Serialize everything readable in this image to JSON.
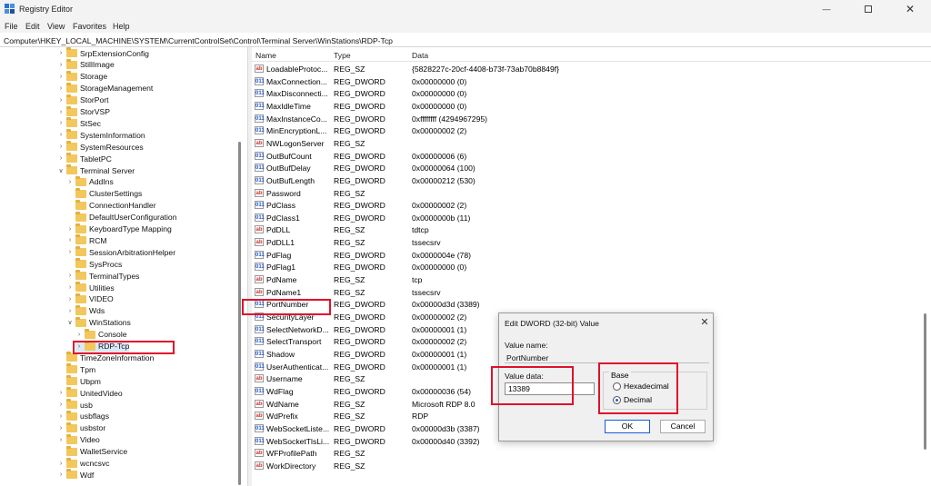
{
  "window": {
    "title": "Registry Editor"
  },
  "menu": [
    "File",
    "Edit",
    "View",
    "Favorites",
    "Help"
  ],
  "address": "Computer\\HKEY_LOCAL_MACHINE\\SYSTEM\\CurrentControlSet\\Control\\Terminal Server\\WinStations\\RDP-Tcp",
  "tree": [
    {
      "label": "SrpExtensionConfig",
      "level": 0,
      "expanded": false
    },
    {
      "label": "StillImage",
      "level": 0,
      "expanded": false
    },
    {
      "label": "Storage",
      "level": 0,
      "expanded": false
    },
    {
      "label": "StorageManagement",
      "level": 0,
      "expanded": false
    },
    {
      "label": "StorPort",
      "level": 0,
      "expanded": false
    },
    {
      "label": "StorVSP",
      "level": 0,
      "expanded": false
    },
    {
      "label": "StSec",
      "level": 0,
      "expanded": false
    },
    {
      "label": "SystemInformation",
      "level": 0,
      "expanded": false
    },
    {
      "label": "SystemResources",
      "level": 0,
      "expanded": false
    },
    {
      "label": "TabletPC",
      "level": 0,
      "expanded": false
    },
    {
      "label": "Terminal Server",
      "level": 0,
      "expanded": true
    },
    {
      "label": "AddIns",
      "level": 1,
      "expanded": false
    },
    {
      "label": "ClusterSettings",
      "level": 1,
      "expanded": false,
      "leaf": true
    },
    {
      "label": "ConnectionHandler",
      "level": 1,
      "expanded": false,
      "leaf": true
    },
    {
      "label": "DefaultUserConfiguration",
      "level": 1,
      "expanded": false,
      "leaf": true
    },
    {
      "label": "KeyboardType Mapping",
      "level": 1,
      "expanded": false
    },
    {
      "label": "RCM",
      "level": 1,
      "expanded": false
    },
    {
      "label": "SessionArbitrationHelper",
      "level": 1,
      "expanded": false
    },
    {
      "label": "SysProcs",
      "level": 1,
      "expanded": false,
      "leaf": true
    },
    {
      "label": "TerminalTypes",
      "level": 1,
      "expanded": false
    },
    {
      "label": "Utilities",
      "level": 1,
      "expanded": false
    },
    {
      "label": "VIDEO",
      "level": 1,
      "expanded": false
    },
    {
      "label": "Wds",
      "level": 1,
      "expanded": false
    },
    {
      "label": "WinStations",
      "level": 1,
      "expanded": true
    },
    {
      "label": "Console",
      "level": 2,
      "expanded": false
    },
    {
      "label": "RDP-Tcp",
      "level": 2,
      "expanded": false,
      "selected": true
    },
    {
      "label": "TimeZoneInformation",
      "level": 0,
      "expanded": false,
      "leaf": true
    },
    {
      "label": "Tpm",
      "level": 0,
      "expanded": false,
      "leaf": true
    },
    {
      "label": "Ubpm",
      "level": 0,
      "expanded": false,
      "leaf": true
    },
    {
      "label": "UnitedVideo",
      "level": 0,
      "expanded": false
    },
    {
      "label": "usb",
      "level": 0,
      "expanded": false
    },
    {
      "label": "usbflags",
      "level": 0,
      "expanded": false
    },
    {
      "label": "usbstor",
      "level": 0,
      "expanded": false
    },
    {
      "label": "Video",
      "level": 0,
      "expanded": false
    },
    {
      "label": "WalletService",
      "level": 0,
      "expanded": false,
      "leaf": true
    },
    {
      "label": "wcncsvc",
      "level": 0,
      "expanded": false
    },
    {
      "label": "Wdf",
      "level": 0,
      "expanded": false
    }
  ],
  "columns": {
    "name": "Name",
    "type": "Type",
    "data": "Data"
  },
  "values": [
    {
      "name": "LoadableProtoc...",
      "type": "REG_SZ",
      "data": "{5828227c-20cf-4408-b73f-73ab70b8849f}"
    },
    {
      "name": "MaxConnection...",
      "type": "REG_DWORD",
      "data": "0x00000000 (0)"
    },
    {
      "name": "MaxDisconnecti...",
      "type": "REG_DWORD",
      "data": "0x00000000 (0)"
    },
    {
      "name": "MaxIdleTime",
      "type": "REG_DWORD",
      "data": "0x00000000 (0)"
    },
    {
      "name": "MaxInstanceCo...",
      "type": "REG_DWORD",
      "data": "0xffffffff (4294967295)"
    },
    {
      "name": "MinEncryptionL...",
      "type": "REG_DWORD",
      "data": "0x00000002 (2)"
    },
    {
      "name": "NWLogonServer",
      "type": "REG_SZ",
      "data": ""
    },
    {
      "name": "OutBufCount",
      "type": "REG_DWORD",
      "data": "0x00000006 (6)"
    },
    {
      "name": "OutBufDelay",
      "type": "REG_DWORD",
      "data": "0x00000064 (100)"
    },
    {
      "name": "OutBufLength",
      "type": "REG_DWORD",
      "data": "0x00000212 (530)"
    },
    {
      "name": "Password",
      "type": "REG_SZ",
      "data": ""
    },
    {
      "name": "PdClass",
      "type": "REG_DWORD",
      "data": "0x00000002 (2)"
    },
    {
      "name": "PdClass1",
      "type": "REG_DWORD",
      "data": "0x0000000b (11)"
    },
    {
      "name": "PdDLL",
      "type": "REG_SZ",
      "data": "tdtcp"
    },
    {
      "name": "PdDLL1",
      "type": "REG_SZ",
      "data": "tssecsrv"
    },
    {
      "name": "PdFlag",
      "type": "REG_DWORD",
      "data": "0x0000004e (78)"
    },
    {
      "name": "PdFlag1",
      "type": "REG_DWORD",
      "data": "0x00000000 (0)"
    },
    {
      "name": "PdName",
      "type": "REG_SZ",
      "data": "tcp"
    },
    {
      "name": "PdName1",
      "type": "REG_SZ",
      "data": "tssecsrv"
    },
    {
      "name": "PortNumber",
      "type": "REG_DWORD",
      "data": "0x00000d3d (3389)"
    },
    {
      "name": "SecurityLayer",
      "type": "REG_DWORD",
      "data": "0x00000002 (2)"
    },
    {
      "name": "SelectNetworkD...",
      "type": "REG_DWORD",
      "data": "0x00000001 (1)"
    },
    {
      "name": "SelectTransport",
      "type": "REG_DWORD",
      "data": "0x00000002 (2)"
    },
    {
      "name": "Shadow",
      "type": "REG_DWORD",
      "data": "0x00000001 (1)"
    },
    {
      "name": "UserAuthenticat...",
      "type": "REG_DWORD",
      "data": "0x00000001 (1)"
    },
    {
      "name": "Username",
      "type": "REG_SZ",
      "data": ""
    },
    {
      "name": "WdFlag",
      "type": "REG_DWORD",
      "data": "0x00000036 (54)"
    },
    {
      "name": "WdName",
      "type": "REG_SZ",
      "data": "Microsoft RDP 8.0"
    },
    {
      "name": "WdPrefix",
      "type": "REG_SZ",
      "data": "RDP"
    },
    {
      "name": "WebSocketListe...",
      "type": "REG_DWORD",
      "data": "0x00000d3b (3387)"
    },
    {
      "name": "WebSocketTlsLi...",
      "type": "REG_DWORD",
      "data": "0x00000d40 (3392)"
    },
    {
      "name": "WFProfilePath",
      "type": "REG_SZ",
      "data": ""
    },
    {
      "name": "WorkDirectory",
      "type": "REG_SZ",
      "data": ""
    }
  ],
  "icons": {
    "sz": "ab",
    "dword": "011"
  },
  "dialog": {
    "title": "Edit DWORD (32-bit) Value",
    "value_name_label": "Value name:",
    "value_name": "PortNumber",
    "value_data_label": "Value data:",
    "value_data": "13389",
    "base_label": "Base",
    "hex_label": "Hexadecimal",
    "dec_label": "Decimal",
    "selected_base": "Decimal",
    "ok_label": "OK",
    "cancel_label": "Cancel"
  },
  "highlight_color": "#e0102b"
}
